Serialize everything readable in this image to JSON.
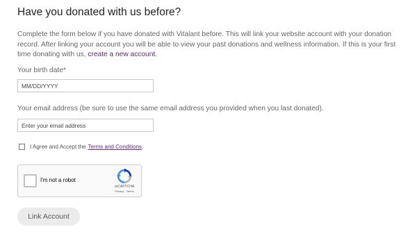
{
  "page": {
    "title": "Have you donated with us before?",
    "intro_text": "Complete the form below if you have donated with Vitalant before. This will link your website account with your donation record. After linking your account you will be able to view your past donations and wellness information. If this is your first time donating with us, ",
    "intro_link": "create a new account",
    "intro_end": "."
  },
  "form": {
    "birth_date": {
      "label": "Your birth date*",
      "placeholder": "MM/DD/YYYY",
      "value": ""
    },
    "email": {
      "label": "Your email address (be sure to use the same email address you provided when you last donated).",
      "placeholder": "Enter your email address",
      "value": ""
    },
    "agree": {
      "text": "I Agree and Accept the",
      "link": "Terms and Conditions",
      "end": ".",
      "checked": false
    },
    "captcha": {
      "label": "I'm not a robot",
      "brand": "reCAPTCHA",
      "links": "Privacy - Terms",
      "checked": false
    },
    "submit_label": "Link Account"
  },
  "colors": {
    "link": "#5b2a6e",
    "button_bg": "#ebebeb",
    "text": "#666666",
    "captcha_blue": "#4a90e2",
    "captcha_gray": "#b3b3b3"
  }
}
